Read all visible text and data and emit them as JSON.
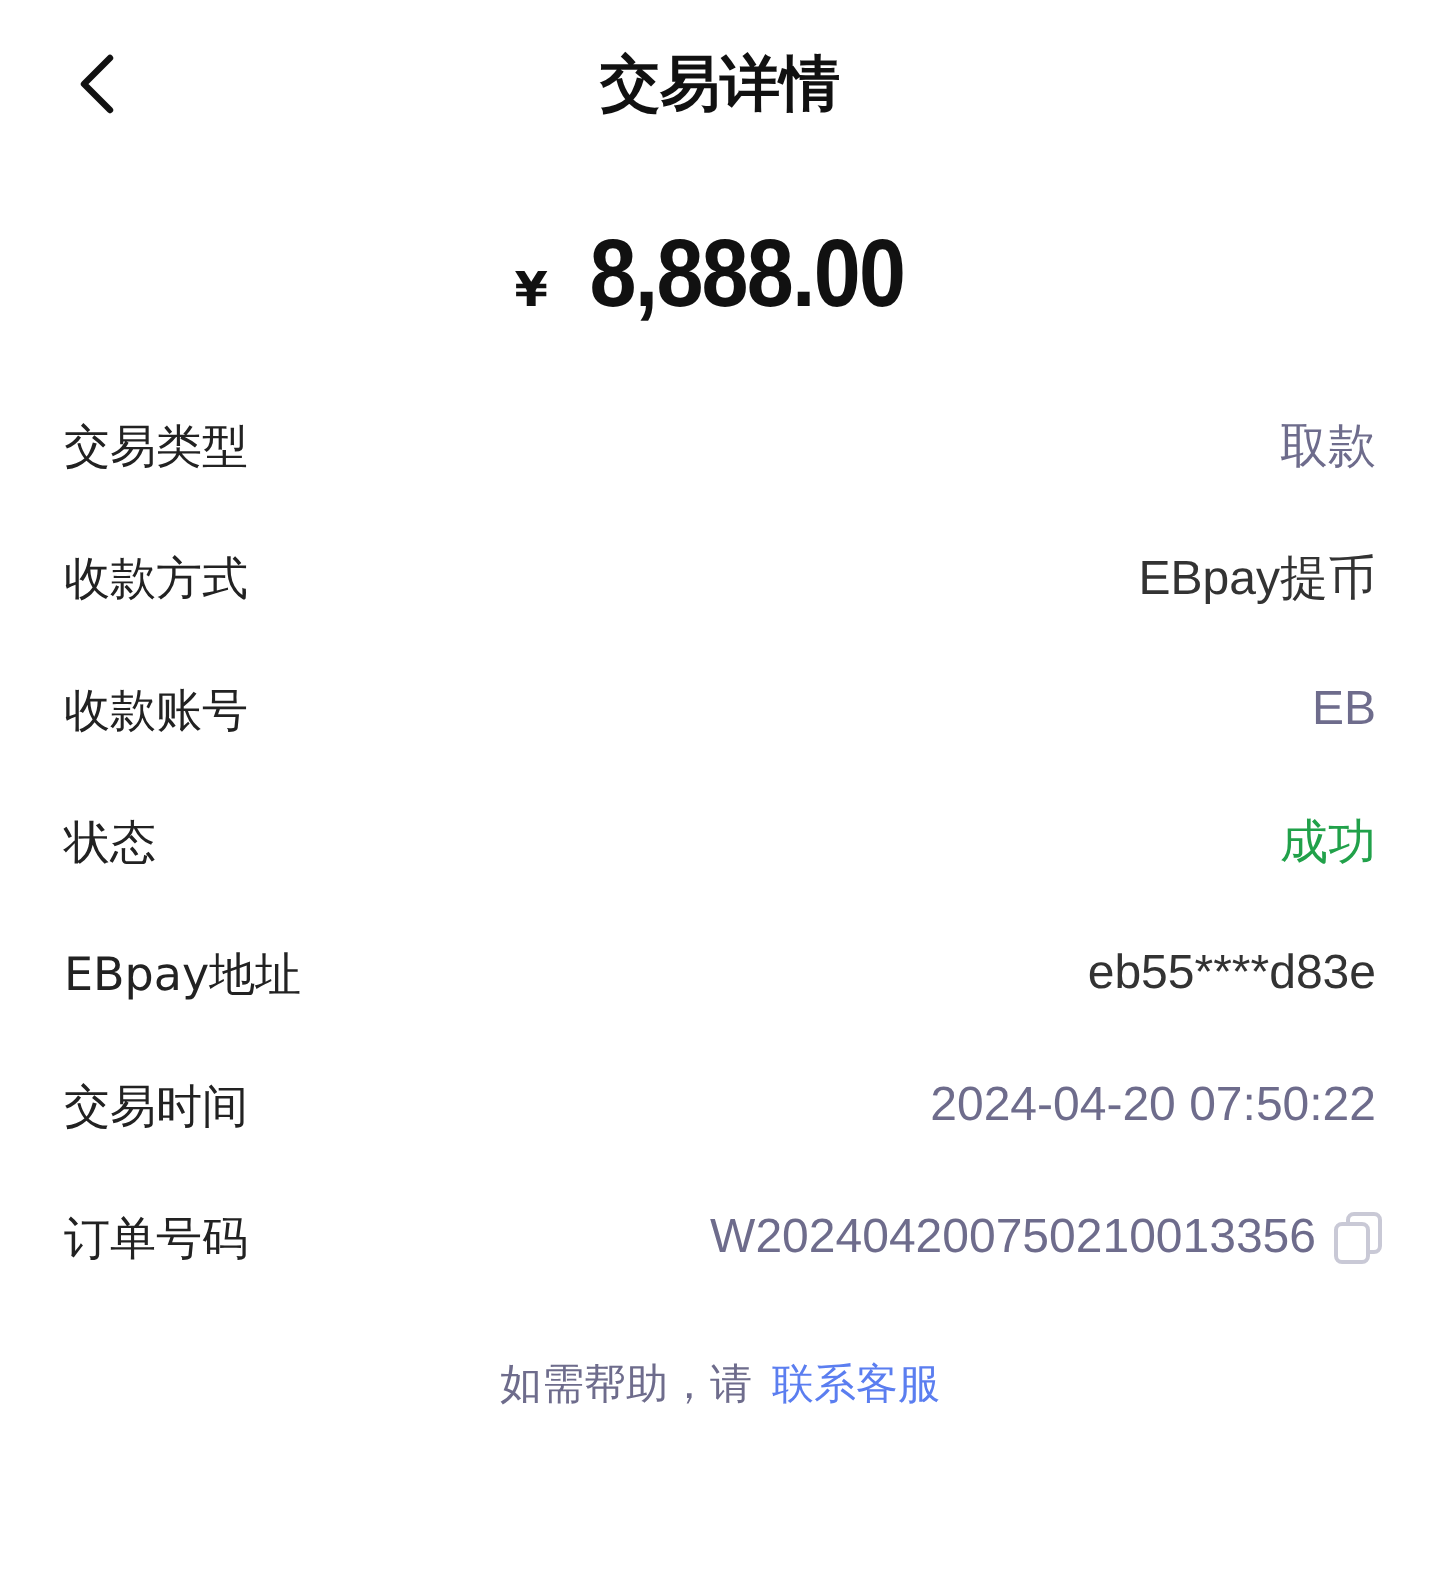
{
  "header": {
    "title": "交易详情"
  },
  "amount": {
    "currency": "¥",
    "value": "8,888.00"
  },
  "rows": [
    {
      "label": "交易类型",
      "value": "取款",
      "color": "#6e6c8c",
      "copyable": false
    },
    {
      "label": "收款方式",
      "value": "EBpay提币",
      "color": "#333333",
      "copyable": false
    },
    {
      "label": "收款账号",
      "value": "EB",
      "color": "#6e6c8c",
      "copyable": false
    },
    {
      "label": "状态",
      "value": "成功",
      "color": "#21a14a",
      "copyable": false
    },
    {
      "label": "EBpay地址",
      "value": "eb55****d83e",
      "color": "#333333",
      "copyable": false
    },
    {
      "label": "交易时间",
      "value": "2024-04-20 07:50:22",
      "color": "#6e6c8c",
      "copyable": false
    },
    {
      "label": "订单号码",
      "value": "W202404200750210013356",
      "color": "#6e6c8c",
      "copyable": true
    }
  ],
  "help": {
    "text": "如需帮助，请",
    "link": "联系客服"
  }
}
